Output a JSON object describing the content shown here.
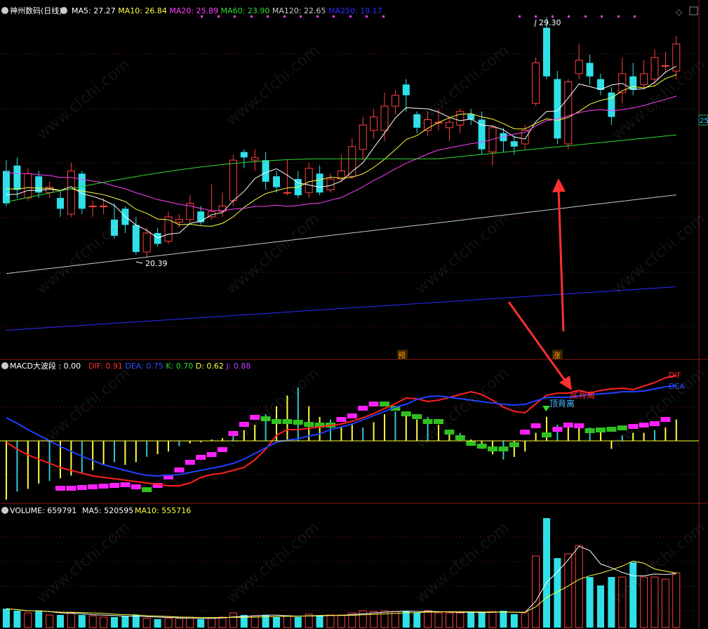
{
  "price_panel": {
    "title": "神州数码(日线)",
    "ma_labels": [
      {
        "text": "MA5: 27.27",
        "color": "#ffffff"
      },
      {
        "text": "MA10: 26.84",
        "color": "#ffff40"
      },
      {
        "text": "MA20: 25.89",
        "color": "#ff40ff"
      },
      {
        "text": "MA60: 23.90",
        "color": "#30d830"
      },
      {
        "text": "MA120: 22.65",
        "color": "#c8c8c8"
      },
      {
        "text": "MA250: 19.17",
        "color": "#2a2aff"
      }
    ],
    "high_label": "29.30",
    "low_label": "20.39",
    "right_tag": "25",
    "marker_yu": "预",
    "marker_zhang": "涨",
    "watermark": "www.cfchi.com"
  },
  "macd_panel": {
    "title": "MACD大波段 : 0.00",
    "labels": [
      {
        "text": "DIF: 0.91",
        "color": "#ff3030"
      },
      {
        "text": "DEA: 0.75",
        "color": "#3050ff"
      },
      {
        "text": "K: 0.70",
        "color": "#30d830"
      },
      {
        "text": "D: 0.62",
        "color": "#ffff40"
      },
      {
        "text": "J: 0.88",
        "color": "#c040ff"
      }
    ],
    "annotation_dibeili": "底背离",
    "annotation_dingbeili": "顶背离",
    "end_dif": "DIF",
    "end_dea": "DEA"
  },
  "volume_panel": {
    "title": "VOLUME: 659791",
    "ma5": "MA5: 520595",
    "ma10": "MA10: 555716"
  },
  "chart_data": {
    "type": "candlestick",
    "title": "神州数码(日线)",
    "annotations": [
      "29.30",
      "20.39",
      "预",
      "涨",
      "底背离",
      "顶背离"
    ],
    "candles": [
      {
        "o": 23.6,
        "c": 22.4,
        "h": 24.0,
        "l": 22.3
      },
      {
        "o": 23.8,
        "c": 22.9,
        "h": 24.1,
        "l": 22.6
      },
      {
        "o": 22.6,
        "c": 23.5,
        "h": 23.7,
        "l": 22.5
      },
      {
        "o": 23.4,
        "c": 22.8,
        "h": 23.6,
        "l": 22.6
      },
      {
        "o": 22.8,
        "c": 23.0,
        "h": 23.2,
        "l": 22.6
      },
      {
        "o": 22.6,
        "c": 22.2,
        "h": 22.9,
        "l": 21.9
      },
      {
        "o": 22.0,
        "c": 23.6,
        "h": 23.9,
        "l": 21.9
      },
      {
        "o": 23.5,
        "c": 22.2,
        "h": 23.6,
        "l": 22.0
      },
      {
        "o": 22.3,
        "c": 22.3,
        "h": 22.5,
        "l": 21.9
      },
      {
        "o": 22.3,
        "c": 22.3,
        "h": 22.6,
        "l": 22.0
      },
      {
        "o": 21.8,
        "c": 21.2,
        "h": 22.4,
        "l": 21.1
      },
      {
        "o": 22.2,
        "c": 21.6,
        "h": 22.3,
        "l": 21.3
      },
      {
        "o": 21.6,
        "c": 20.6,
        "h": 21.9,
        "l": 20.5
      },
      {
        "o": 20.6,
        "c": 21.3,
        "h": 21.5,
        "l": 20.39
      },
      {
        "o": 21.3,
        "c": 20.9,
        "h": 21.5,
        "l": 20.8
      },
      {
        "o": 21.0,
        "c": 21.9,
        "h": 22.1,
        "l": 20.9
      },
      {
        "o": 21.7,
        "c": 21.8,
        "h": 22.0,
        "l": 21.5
      },
      {
        "o": 21.8,
        "c": 22.4,
        "h": 22.7,
        "l": 21.7
      },
      {
        "o": 22.1,
        "c": 21.7,
        "h": 22.3,
        "l": 21.6
      },
      {
        "o": 21.9,
        "c": 22.1,
        "h": 23.1,
        "l": 21.8
      },
      {
        "o": 22.1,
        "c": 22.3,
        "h": 22.8,
        "l": 21.9
      },
      {
        "o": 22.5,
        "c": 24.0,
        "h": 24.2,
        "l": 22.3
      },
      {
        "o": 24.3,
        "c": 24.1,
        "h": 24.4,
        "l": 23.7
      },
      {
        "o": 24.0,
        "c": 24.1,
        "h": 24.4,
        "l": 23.6
      },
      {
        "o": 24.0,
        "c": 23.2,
        "h": 24.3,
        "l": 22.9
      },
      {
        "o": 23.4,
        "c": 23.0,
        "h": 23.6,
        "l": 22.8
      },
      {
        "o": 22.8,
        "c": 22.8,
        "h": 24.0,
        "l": 22.7
      },
      {
        "o": 23.3,
        "c": 22.7,
        "h": 23.6,
        "l": 22.6
      },
      {
        "o": 22.8,
        "c": 23.7,
        "h": 23.9,
        "l": 22.6
      },
      {
        "o": 23.5,
        "c": 22.8,
        "h": 23.8,
        "l": 22.7
      },
      {
        "o": 22.9,
        "c": 23.3,
        "h": 23.5,
        "l": 22.8
      },
      {
        "o": 23.3,
        "c": 23.6,
        "h": 24.2,
        "l": 23.2
      },
      {
        "o": 23.4,
        "c": 24.5,
        "h": 24.8,
        "l": 23.3
      },
      {
        "o": 24.4,
        "c": 25.3,
        "h": 25.6,
        "l": 24.0
      },
      {
        "o": 25.1,
        "c": 25.6,
        "h": 25.9,
        "l": 24.8
      },
      {
        "o": 25.1,
        "c": 26.0,
        "h": 26.5,
        "l": 24.7
      },
      {
        "o": 26.0,
        "c": 26.4,
        "h": 26.6,
        "l": 25.7
      },
      {
        "o": 26.8,
        "c": 26.4,
        "h": 27.0,
        "l": 25.8
      },
      {
        "o": 25.7,
        "c": 25.2,
        "h": 25.8,
        "l": 25.0
      },
      {
        "o": 25.1,
        "c": 25.5,
        "h": 25.8,
        "l": 24.9
      },
      {
        "o": 25.4,
        "c": 25.4,
        "h": 25.9,
        "l": 25.1
      },
      {
        "o": 25.2,
        "c": 25.4,
        "h": 25.6,
        "l": 24.7
      },
      {
        "o": 25.3,
        "c": 25.8,
        "h": 25.9,
        "l": 25.0
      },
      {
        "o": 25.7,
        "c": 25.5,
        "h": 25.9,
        "l": 25.3
      },
      {
        "o": 25.5,
        "c": 24.4,
        "h": 25.8,
        "l": 24.2
      },
      {
        "o": 24.3,
        "c": 25.2,
        "h": 25.3,
        "l": 23.8
      },
      {
        "o": 25.0,
        "c": 24.7,
        "h": 25.2,
        "l": 24.3
      },
      {
        "o": 24.7,
        "c": 24.5,
        "h": 24.9,
        "l": 24.2
      },
      {
        "o": 24.6,
        "c": 25.1,
        "h": 25.3,
        "l": 24.4
      },
      {
        "o": 26.1,
        "c": 27.6,
        "h": 27.8,
        "l": 26.0
      },
      {
        "o": 28.9,
        "c": 27.1,
        "h": 29.3,
        "l": 27.0
      },
      {
        "o": 27.0,
        "c": 24.8,
        "h": 27.3,
        "l": 24.6
      },
      {
        "o": 24.6,
        "c": 26.9,
        "h": 27.0,
        "l": 24.4
      },
      {
        "o": 27.2,
        "c": 27.7,
        "h": 28.3,
        "l": 27.0
      },
      {
        "o": 27.6,
        "c": 27.1,
        "h": 27.9,
        "l": 26.8
      },
      {
        "o": 27.0,
        "c": 26.6,
        "h": 27.2,
        "l": 26.4
      },
      {
        "o": 26.5,
        "c": 25.6,
        "h": 26.7,
        "l": 25.3
      },
      {
        "o": 26.5,
        "c": 27.2,
        "h": 27.8,
        "l": 26.1
      },
      {
        "o": 27.1,
        "c": 26.6,
        "h": 27.6,
        "l": 26.4
      },
      {
        "o": 26.8,
        "c": 27.2,
        "h": 27.7,
        "l": 26.7
      },
      {
        "o": 27.0,
        "c": 27.8,
        "h": 28.1,
        "l": 26.8
      },
      {
        "o": 27.5,
        "c": 27.5,
        "h": 28.0,
        "l": 27.2
      },
      {
        "o": 27.3,
        "c": 28.3,
        "h": 28.6,
        "l": 27.0
      }
    ],
    "ma_series": [
      {
        "name": "MA5",
        "last": 27.27
      },
      {
        "name": "MA10",
        "last": 26.84
      },
      {
        "name": "MA20",
        "last": 25.89
      },
      {
        "name": "MA60",
        "last": 23.9
      },
      {
        "name": "MA120",
        "last": 22.65
      },
      {
        "name": "MA250",
        "last": 19.17
      }
    ],
    "volume": {
      "last": 659791,
      "ma5_last": 520595,
      "ma10_last": 555716
    }
  }
}
